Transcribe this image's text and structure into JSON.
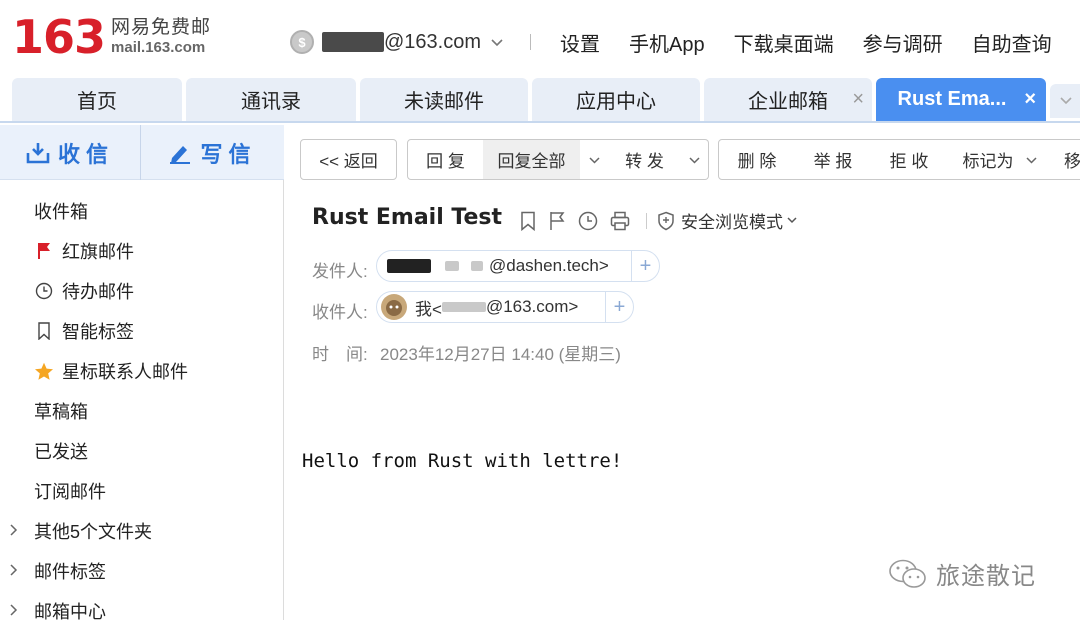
{
  "header": {
    "logo_number": "163",
    "logo_cn": "网易免费邮",
    "logo_domain": "mail.163.com",
    "account_email_suffix": "@163.com",
    "links": [
      "设置",
      "手机App",
      "下载桌面端",
      "参与调研",
      "自助查询"
    ]
  },
  "tabs": [
    {
      "label": "首页"
    },
    {
      "label": "通讯录"
    },
    {
      "label": "未读邮件"
    },
    {
      "label": "应用中心"
    },
    {
      "label": "企业邮箱"
    },
    {
      "label": "Rust Ema..."
    }
  ],
  "sidebar": {
    "receive_label": "收信",
    "compose_label": "写信",
    "folders": [
      {
        "label": "收件箱",
        "icon": ""
      },
      {
        "label": "红旗邮件",
        "icon": "red-flag-icon"
      },
      {
        "label": "待办邮件",
        "icon": "clock-icon"
      },
      {
        "label": "智能标签",
        "icon": "bookmark-icon"
      },
      {
        "label": "星标联系人邮件",
        "icon": "star-icon"
      },
      {
        "label": "草稿箱",
        "icon": ""
      },
      {
        "label": "已发送",
        "icon": ""
      },
      {
        "label": "订阅邮件",
        "icon": ""
      },
      {
        "label": "其他5个文件夹",
        "icon": "chevron-right-icon"
      },
      {
        "label": "邮件标签",
        "icon": "chevron-right-icon"
      },
      {
        "label": "邮箱中心",
        "icon": "chevron-right-icon"
      }
    ]
  },
  "toolbar": {
    "back": "<< 返回",
    "reply": "回 复",
    "reply_all": "回复全部",
    "forward": "转 发",
    "delete": "删 除",
    "report": "举 报",
    "reject": "拒 收",
    "mark_as": "标记为",
    "move_partial": "移"
  },
  "mail": {
    "subject": "Rust Email Test",
    "safe_mode": "安全浏览模式",
    "from_label": "发件人:",
    "from_suffix": "@dashen.tech>",
    "to_label": "收件人:",
    "to_prefix": "我<",
    "to_suffix": "@163.com>",
    "time_label": "时　间:",
    "time_value": "2023年12月27日 14:40 (星期三)",
    "body": "Hello from Rust with lettre!"
  },
  "watermark": "旅途散记",
  "colors": {
    "brand_red": "#d8202a",
    "accent_blue": "#4a8ff0",
    "compose_blue": "#2b73d6",
    "tab_bg": "#e8eef7"
  }
}
